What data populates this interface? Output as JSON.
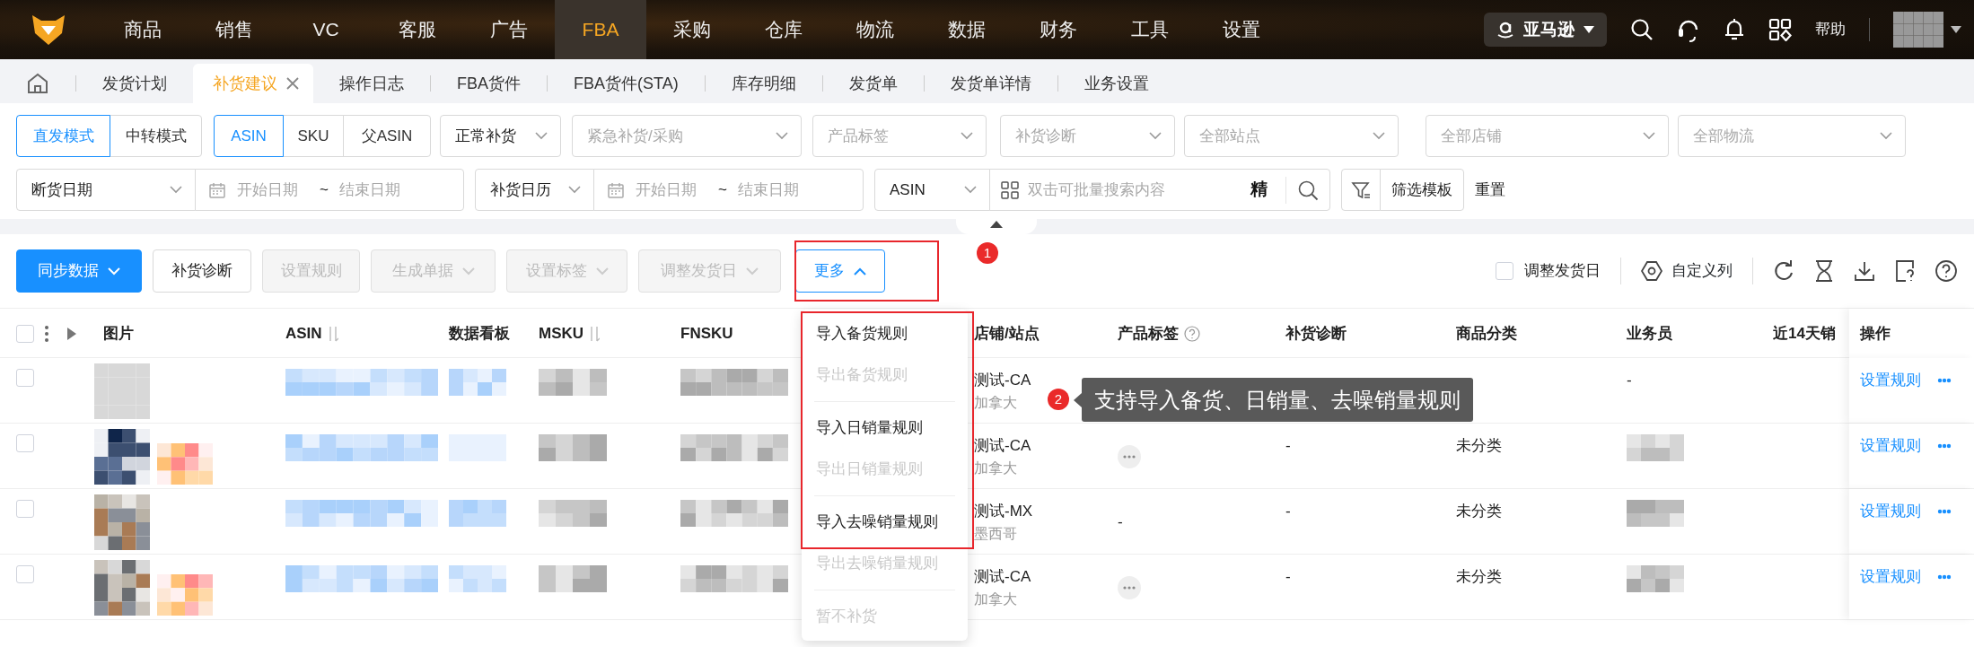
{
  "top_nav": {
    "items": [
      {
        "label": "商品",
        "selected": false
      },
      {
        "label": "销售",
        "selected": false
      },
      {
        "label": "VC",
        "selected": false
      },
      {
        "label": "客服",
        "selected": false
      },
      {
        "label": "广告",
        "selected": false
      },
      {
        "label": "FBA",
        "selected": true
      },
      {
        "label": "采购",
        "selected": false
      },
      {
        "label": "仓库",
        "selected": false
      },
      {
        "label": "物流",
        "selected": false
      },
      {
        "label": "数据",
        "selected": false
      },
      {
        "label": "财务",
        "selected": false
      },
      {
        "label": "工具",
        "selected": false
      },
      {
        "label": "设置",
        "selected": false
      }
    ],
    "platform": "亚马逊",
    "help": "帮助"
  },
  "tabs": [
    {
      "label": "发货计划",
      "selected": false,
      "closable": false
    },
    {
      "label": "补货建议",
      "selected": true,
      "closable": true
    },
    {
      "label": "操作日志",
      "selected": false,
      "closable": false
    },
    {
      "label": "FBA货件",
      "selected": false,
      "closable": false
    },
    {
      "label": "FBA货件(STA)",
      "selected": false,
      "closable": false
    },
    {
      "label": "库存明细",
      "selected": false,
      "closable": false
    },
    {
      "label": "发货单",
      "selected": false,
      "closable": false
    },
    {
      "label": "发货单详情",
      "selected": false,
      "closable": false
    },
    {
      "label": "业务设置",
      "selected": false,
      "closable": false
    }
  ],
  "filters": {
    "mode": [
      {
        "label": "直发模式",
        "selected": true
      },
      {
        "label": "中转模式",
        "selected": false
      }
    ],
    "id_type": [
      {
        "label": "ASIN",
        "selected": true
      },
      {
        "label": "SKU",
        "selected": false
      },
      {
        "label": "父ASIN",
        "selected": false
      }
    ],
    "selects": [
      {
        "value": "正常补货"
      },
      {
        "placeholder": "紧急补货/采购"
      },
      {
        "placeholder": "产品标签"
      },
      {
        "placeholder": "补货诊断"
      },
      {
        "placeholder": "全部站点"
      },
      {
        "placeholder": "全部店铺"
      },
      {
        "placeholder": "全部物流"
      }
    ],
    "date_ranges": [
      {
        "type": "断货日期",
        "start_placeholder": "开始日期",
        "separator": "~",
        "end_placeholder": "结束日期"
      },
      {
        "type": "补货日历",
        "start_placeholder": "开始日期",
        "separator": "~",
        "end_placeholder": "结束日期"
      }
    ],
    "search": {
      "field": "ASIN",
      "placeholder": "双击可批量搜索内容",
      "precise": "精"
    },
    "template_button": "筛选模板",
    "reset": "重置"
  },
  "toolbar": {
    "buttons": [
      {
        "label": "同步数据",
        "kind": "primary",
        "disabled": false,
        "expanded": false
      },
      {
        "label": "补货诊断",
        "kind": "default",
        "disabled": false
      },
      {
        "label": "设置规则",
        "kind": "default",
        "disabled": true
      },
      {
        "label": "生成单据",
        "kind": "default",
        "disabled": true,
        "expanded": false
      },
      {
        "label": "设置标签",
        "kind": "default",
        "disabled": true,
        "expanded": false
      },
      {
        "label": "调整发货日",
        "kind": "default",
        "disabled": true,
        "expanded": false
      },
      {
        "label": "更多",
        "kind": "outline",
        "disabled": false,
        "expanded": true
      }
    ],
    "adjust_ship_date": {
      "label": "调整发货日",
      "checked": false
    },
    "custom_columns": "自定义列"
  },
  "more_menu": {
    "groups": [
      {
        "items": [
          {
            "label": "导入备货规则",
            "disabled": false
          },
          {
            "label": "导出备货规则",
            "disabled": true
          }
        ]
      },
      {
        "items": [
          {
            "label": "导入日销量规则",
            "disabled": false
          },
          {
            "label": "导出日销量规则",
            "disabled": true
          }
        ]
      },
      {
        "items": [
          {
            "label": "导入去噪销量规则",
            "disabled": false
          },
          {
            "label": "导出去噪销量规则",
            "disabled": true
          }
        ]
      },
      {
        "items": [
          {
            "label": "暂不补货",
            "disabled": true
          }
        ]
      }
    ]
  },
  "table": {
    "select_all_checked": false,
    "columns": [
      {
        "label": "图片"
      },
      {
        "label": "ASIN",
        "sortable": true
      },
      {
        "label": "数据看板"
      },
      {
        "label": "MSKU",
        "sortable": true
      },
      {
        "label": "FNSKU"
      },
      {
        "label": "店铺/站点"
      },
      {
        "label": "产品标签",
        "help": true
      },
      {
        "label": "补货诊断"
      },
      {
        "label": "商品分类"
      },
      {
        "label": "业务员"
      },
      {
        "label": "近14天销"
      },
      {
        "label": "操作"
      }
    ],
    "rows": [
      {
        "checked": false,
        "variant_thumb": false,
        "store": "测试-CA",
        "site": "加拿大",
        "salesperson": "-",
        "action": "设置规则"
      },
      {
        "checked": false,
        "variant_thumb": true,
        "store": "测试-CA",
        "site": "加拿大",
        "tag": {
          "kind": "more"
        },
        "diagnosis": "-",
        "category": "未分类",
        "salesperson_blurred": true,
        "action": "设置规则"
      },
      {
        "checked": false,
        "variant_thumb": false,
        "store": "测试-MX",
        "site": "墨西哥",
        "tag": {
          "kind": "text",
          "text": "-"
        },
        "diagnosis": "-",
        "category": "未分类",
        "salesperson_blurred": true,
        "action": "设置规则"
      },
      {
        "checked": false,
        "variant_thumb": true,
        "store": "测试-CA",
        "site": "加拿大",
        "tag": {
          "kind": "more"
        },
        "diagnosis": "-",
        "category": "未分类",
        "salesperson_blurred": true,
        "action": "设置规则"
      }
    ]
  },
  "annotations": [
    {
      "label": "1"
    },
    {
      "label": "2",
      "text": "支持导入备货、日销量、去噪销量规则"
    }
  ]
}
